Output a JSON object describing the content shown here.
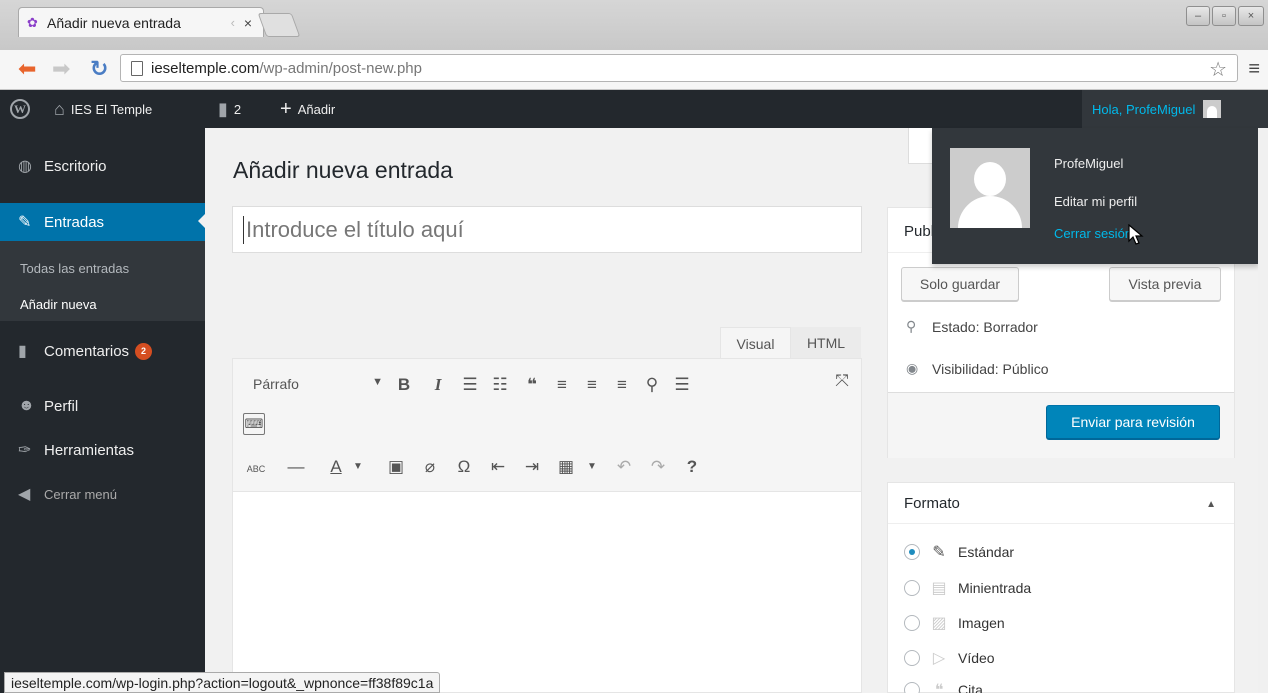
{
  "browser": {
    "tab_title": "Añadir nueva entrada",
    "tab_fade": "‹",
    "tab_close": "×",
    "url_host": "ieseltemple.com",
    "url_path": "/wp-admin/post-new.php",
    "status_url": "ieseltemple.com/wp-login.php?action=logout&_wpnonce=ff38f89c1a"
  },
  "adminbar": {
    "site_name": "IES El Temple",
    "comments_count": "2",
    "new_label": "Añadir",
    "greeting": "Hola, ProfeMiguel"
  },
  "user_menu": {
    "username": "ProfeMiguel",
    "edit_profile": "Editar mi perfil",
    "logout": "Cerrar sesión"
  },
  "sidebar": {
    "dashboard": "Escritorio",
    "posts": "Entradas",
    "all_posts": "Todas las entradas",
    "add_new": "Añadir nueva",
    "comments": "Comentarios",
    "comments_badge": "2",
    "profile": "Perfil",
    "tools": "Herramientas",
    "collapse": "Cerrar menú"
  },
  "main": {
    "page_title": "Añadir nueva entrada",
    "title_placeholder": "Introduce el título aquí",
    "tab_visual": "Visual",
    "tab_html": "HTML",
    "format_select": "Párrafo"
  },
  "publish_box": {
    "title": "Publicar",
    "save_draft": "Solo guardar",
    "preview": "Vista previa",
    "status": "Estado: Borrador",
    "visibility": "Visibilidad: Público",
    "submit": "Enviar para revisión"
  },
  "format_box": {
    "title": "Formato",
    "options": [
      "Estándar",
      "Minientrada",
      "Imagen",
      "Vídeo",
      "Cita"
    ],
    "selected": "Estándar"
  },
  "colors": {
    "adminbar": "#23282d",
    "accent": "#0073aa",
    "primary_button": "#0085ba",
    "link_hover": "#00b9eb",
    "badge": "#d54e21"
  }
}
